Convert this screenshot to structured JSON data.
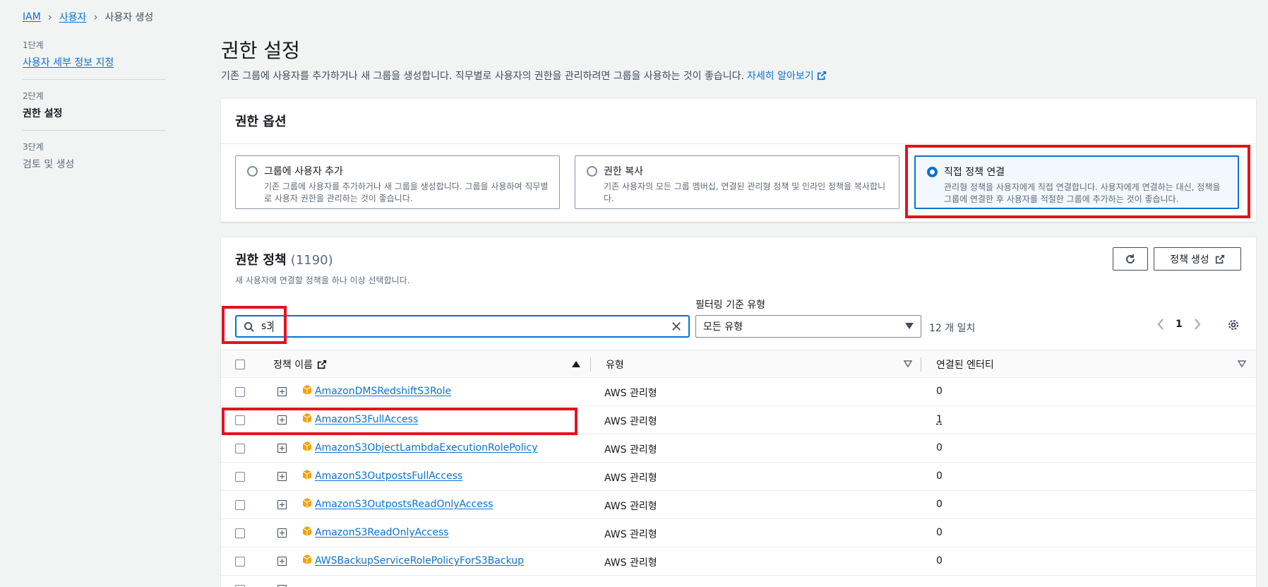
{
  "breadcrumb": {
    "root": "IAM",
    "users": "사용자",
    "current": "사용자 생성"
  },
  "steps": [
    {
      "no": "1단계",
      "label": "사용자 세부 정보 지정"
    },
    {
      "no": "2단계",
      "label": "권한 설정"
    },
    {
      "no": "3단계",
      "label": "검토 및 생성"
    }
  ],
  "page": {
    "title": "권한 설정",
    "desc": "기존 그룹에 사용자를 추가하거나 새 그룹을 생성합니다. 직무별로 사용자의 권한을 관리하려면 그룹을 사용하는 것이 좋습니다.",
    "learn_more": "자세히 알아보기"
  },
  "options_panel": {
    "title": "권한 옵션",
    "options": [
      {
        "title": "그룹에 사용자 추가",
        "desc": "기존 그룹에 사용자를 추가하거나 새 그룹을 생성합니다. 그룹을 사용하여 직무별로 사용자 권한을 관리하는 것이 좋습니다."
      },
      {
        "title": "권한 복사",
        "desc": "기존 사용자의 모든 그룹 멤버십, 연결된 관리형 정책 및 인라인 정책을 복사합니다."
      },
      {
        "title": "직접 정책 연결",
        "desc": "관리형 정책을 사용자에게 직접 연결합니다. 사용자에게 연결하는 대신, 정책을 그룹에 연결한 후 사용자를 적절한 그룹에 추가하는 것이 좋습니다."
      }
    ]
  },
  "policies": {
    "title": "권한 정책",
    "count": "(1190)",
    "desc": "새 사용자에 연결할 정책을 하나 이상 선택합니다.",
    "create_label": "정책 생성",
    "search_value": "s3",
    "filter_label": "필터링 기준 유형",
    "filter_value": "모든 유형",
    "match_text": "12 개 일치",
    "page": "1",
    "columns": {
      "name": "정책 이름",
      "type": "유형",
      "entities": "연결된 엔터티"
    },
    "rows": [
      {
        "name": "AmazonDMSRedshiftS3Role",
        "type": "AWS 관리형",
        "entities": "0"
      },
      {
        "name": "AmazonS3FullAccess",
        "type": "AWS 관리형",
        "entities": "1"
      },
      {
        "name": "AmazonS3ObjectLambdaExecutionRolePolicy",
        "type": "AWS 관리형",
        "entities": "0"
      },
      {
        "name": "AmazonS3OutpostsFullAccess",
        "type": "AWS 관리형",
        "entities": "0"
      },
      {
        "name": "AmazonS3OutpostsReadOnlyAccess",
        "type": "AWS 관리형",
        "entities": "0"
      },
      {
        "name": "AmazonS3ReadOnlyAccess",
        "type": "AWS 관리형",
        "entities": "0"
      },
      {
        "name": "AWSBackupServiceRolePolicyForS3Backup",
        "type": "AWS 관리형",
        "entities": "0"
      }
    ]
  },
  "colors": {
    "link": "#0972d3",
    "highlight": "#e3131d",
    "policy_icon": "#f2a20a"
  }
}
